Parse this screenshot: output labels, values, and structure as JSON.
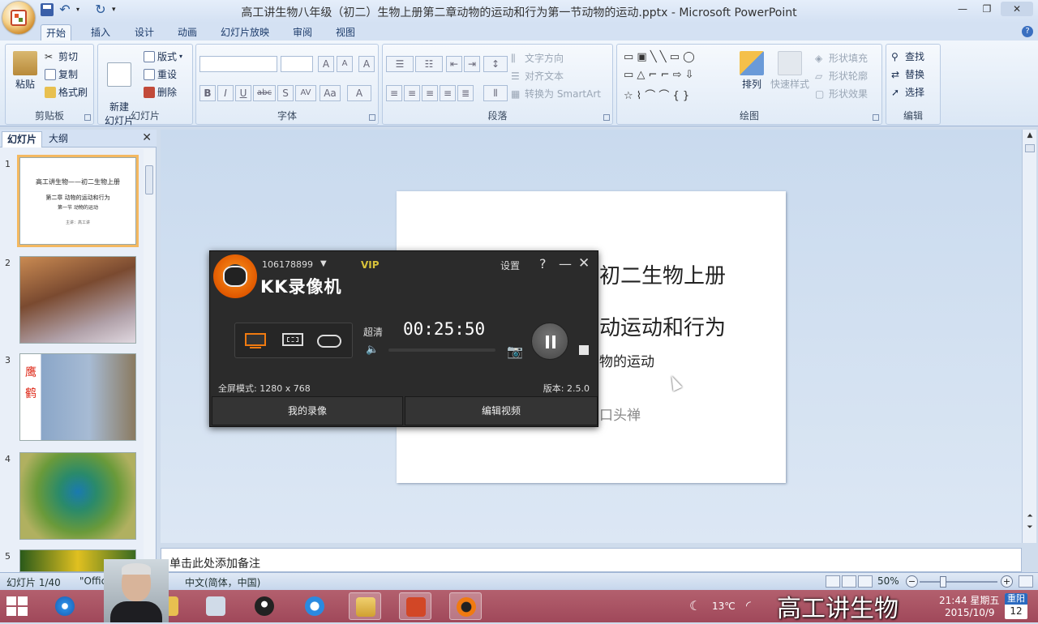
{
  "window": {
    "title": "高工讲生物八年级（初二）生物上册第二章动物的运动和行为第一节动物的运动.pptx - Microsoft PowerPoint"
  },
  "ribbon_tabs": [
    "开始",
    "插入",
    "设计",
    "动画",
    "幻灯片放映",
    "审阅",
    "视图"
  ],
  "ribbon": {
    "clipboard": {
      "paste": "粘贴",
      "cut": "剪切",
      "copy": "复制",
      "format_painter": "格式刷",
      "label": "剪贴板"
    },
    "slides": {
      "new_slide": "新建\n幻灯片",
      "layout": "版式",
      "reset": "重设",
      "delete": "删除",
      "label": "幻灯片"
    },
    "font": {
      "label": "字体",
      "bold": "B",
      "italic": "I",
      "underline": "U",
      "strike": "abc",
      "shadow": "S",
      "spacing": "AV",
      "case": "Aa",
      "grow": "A",
      "shrink": "A",
      "clear": "A",
      "color": "A"
    },
    "paragraph": {
      "text_direction": "文字方向",
      "align_text": "对齐文本",
      "smartart": "转换为 SmartArt",
      "label": "段落"
    },
    "drawing": {
      "arrange": "排列",
      "quick_styles": "快速样式",
      "shape_fill": "形状填充",
      "shape_outline": "形状轮廓",
      "shape_effects": "形状效果",
      "label": "绘图"
    },
    "editing": {
      "find": "查找",
      "replace": "替换",
      "select": "选择",
      "label": "编辑"
    }
  },
  "panel": {
    "tab_slides": "幻灯片",
    "tab_outline": "大纲",
    "close": "✕"
  },
  "thumbnails": [
    {
      "num": "1",
      "line1": "高工讲生物——初二生物上册",
      "line2": "第二章 动物的运动和行为",
      "line3": "第一节 动物的运动",
      "line4": "主讲：高工讲"
    },
    {
      "num": "2"
    },
    {
      "num": "3",
      "side_text": "鹰\n鹤"
    },
    {
      "num": "4"
    },
    {
      "num": "5"
    }
  ],
  "slide": {
    "line1": "初二生物上册",
    "line2": "动运动和行为",
    "line3": "物的运动",
    "line4": "口头禅"
  },
  "notes": {
    "placeholder": "单击此处添加备注"
  },
  "statusbar": {
    "slide_count": "幻灯片 1/40",
    "theme": "\"Office",
    "language": "中文(简体，中国)",
    "zoom": "50%",
    "zoom_fraction": 0.3
  },
  "kk": {
    "account": "106178899",
    "vip": "VIP",
    "app_name": "KK录像机",
    "settings": "设置",
    "help": "?",
    "minimize": "—",
    "close": "✕",
    "quality": "超清",
    "timer": "00:25:50",
    "mode": "全屏模式: 1280 x 768",
    "version": "版本: 2.5.0",
    "my_recordings": "我的录像",
    "edit_video": "编辑视频",
    "volume_fraction": 0.0
  },
  "taskbar": {
    "weather": "13℃",
    "time": "21:44 星期五",
    "date": "2015/10/9",
    "calendar_header": "重阳",
    "calendar_day": "12"
  },
  "watermark": "高工讲生物",
  "colors": {
    "ribbon_bg": "#dbe7f5",
    "kk_bg": "#2b2b2b",
    "taskbar": "#a84e60",
    "accent_orange": "#f07a10"
  }
}
